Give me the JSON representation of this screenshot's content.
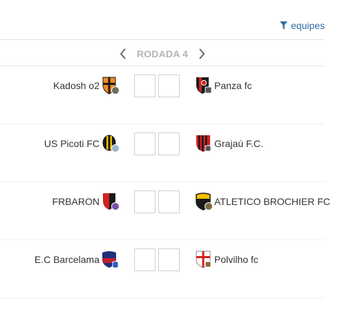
{
  "filter": {
    "label": "equipes",
    "icon": "filter-icon"
  },
  "round": {
    "label": "RODADA 4",
    "prev_icon": "chevron-left-icon",
    "next_icon": "chevron-right-icon"
  },
  "matches": [
    {
      "home": {
        "name": "Kadosh o2",
        "crest": "shield-orange-black-cross"
      },
      "away": {
        "name": "Panza fc",
        "crest": "shield-black-red-ball"
      },
      "home_score": "",
      "away_score": ""
    },
    {
      "home": {
        "name": "US Picoti FC",
        "crest": "shield-black-yellow-stripes"
      },
      "away": {
        "name": "Grajaú F.C.",
        "crest": "shield-red-black-stripes"
      },
      "home_score": "",
      "away_score": ""
    },
    {
      "home": {
        "name": "FRBARON",
        "crest": "shield-red-black-halves"
      },
      "away": {
        "name": "ATLETICO BROCHIER FC",
        "crest": "shield-yellow-black"
      },
      "home_score": "",
      "away_score": ""
    },
    {
      "home": {
        "name": "E.C Barcelama",
        "crest": "shield-navy-red"
      },
      "away": {
        "name": "Polvilho fc",
        "crest": "shield-white-red-cross"
      },
      "home_score": "",
      "away_score": ""
    }
  ],
  "colors": {
    "link": "#2f6ea7",
    "round_label": "#b3b3b3",
    "divider": "#e2e2e2"
  }
}
